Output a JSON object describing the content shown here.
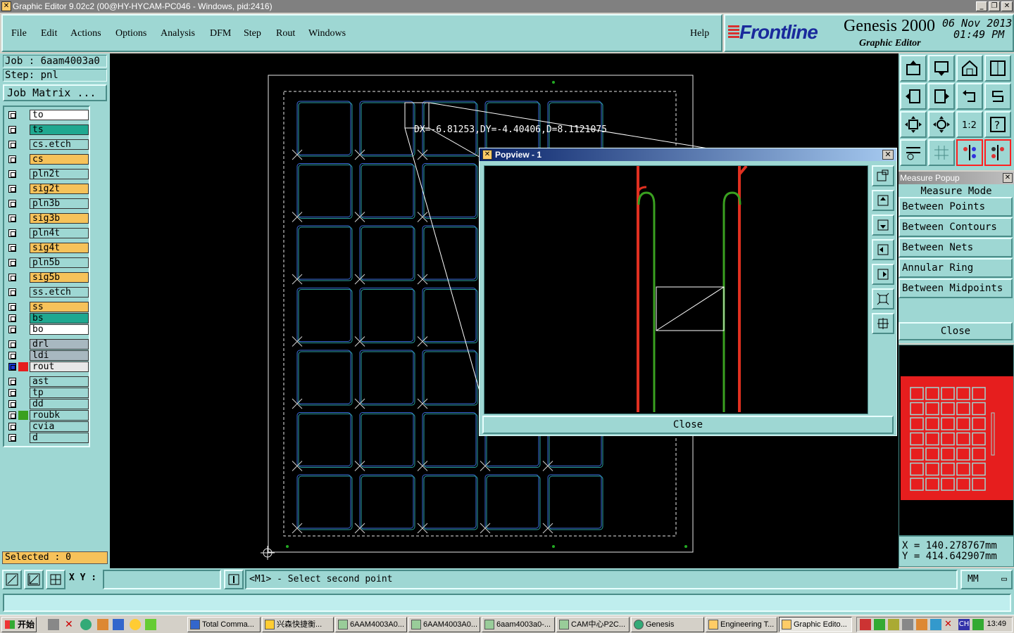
{
  "window": {
    "title": "Graphic Editor 9.02c2 (00@HY-HYCAM-PC046 - Windows, pid:2416)"
  },
  "menu": {
    "items": [
      "File",
      "Edit",
      "Actions",
      "Options",
      "Analysis",
      "DFM",
      "Step",
      "Rout",
      "Windows"
    ],
    "help": "Help"
  },
  "brand": {
    "logo": "Frontline",
    "product": "Genesis 2000",
    "subtitle": "Graphic Editor",
    "date": "06 Nov 2013",
    "time": "01:49 PM"
  },
  "job": {
    "job_label": "Job : 6aam4003a0",
    "step_label": "Step: pnl",
    "matrix_button": "Job Matrix ..."
  },
  "layers": [
    {
      "name": "to",
      "color": "#ffffff"
    },
    {
      "name": "ts",
      "color": "#1fa890"
    },
    {
      "name": "cs.etch",
      "color": "#9ed7d3"
    },
    {
      "name": "cs",
      "color": "#f6c25a"
    },
    {
      "name": "pln2t",
      "color": "#9ed7d3"
    },
    {
      "name": "sig2t",
      "color": "#f6c25a"
    },
    {
      "name": "pln3b",
      "color": "#9ed7d3"
    },
    {
      "name": "sig3b",
      "color": "#f6c25a"
    },
    {
      "name": "pln4t",
      "color": "#9ed7d3"
    },
    {
      "name": "sig4t",
      "color": "#f6c25a"
    },
    {
      "name": "pln5b",
      "color": "#9ed7d3"
    },
    {
      "name": "sig5b",
      "color": "#f6c25a"
    },
    {
      "name": "ss.etch",
      "color": "#9ed7d3"
    },
    {
      "name": "ss",
      "color": "#f6c25a"
    },
    {
      "name": "bs",
      "color": "#1fa890"
    },
    {
      "name": "bo",
      "color": "#ffffff"
    },
    {
      "name": "drl",
      "color": "#a8b8c0"
    },
    {
      "name": "ldi",
      "color": "#a8b8c0"
    },
    {
      "name": "rout",
      "color": "#e8e8e8"
    },
    {
      "name": "ast",
      "color": "#9ed7d3"
    },
    {
      "name": "tp",
      "color": "#9ed7d3"
    },
    {
      "name": "dd",
      "color": "#9ed7d3"
    },
    {
      "name": "roubk",
      "color": "#9ed7d3"
    },
    {
      "name": "cvia",
      "color": "#9ed7d3"
    },
    {
      "name": "d",
      "color": "#9ed7d3"
    }
  ],
  "selected": "Selected : 0",
  "canvas": {
    "measure_text": "DX=-6.81253,DY=-4.40406,D=8.1121075"
  },
  "popview": {
    "title": "Popview - 1",
    "close": "Close"
  },
  "measure": {
    "title": "Measure Popup",
    "mode_label": "Measure Mode",
    "options": [
      "Between Points",
      "Between Contours",
      "Between Nets",
      "Annular Ring",
      "Between Midpoints"
    ],
    "close": "Close"
  },
  "coords": {
    "x": "X = 140.278767mm",
    "y": "Y = 414.642907mm"
  },
  "bottom": {
    "xy_label": "X Y :",
    "xy_value": "",
    "prompt": "<M1> - Select second point",
    "units": "MM"
  },
  "taskbar": {
    "start": "开始",
    "tasks": [
      "Total Comma...",
      "兴森快捷衡...",
      "6AAM4003A0...",
      "6AAM4003A0...",
      "6aam4003a0-...",
      "CAM中心P2C...",
      "Genesis",
      "Engineering T...",
      "Graphic Edito..."
    ],
    "clock": "13:49"
  },
  "colors": {
    "panel": "#9ed7d3",
    "layer_yellow": "#f6c25a",
    "board_line": "#3a6ad8",
    "trace_red": "#e03020",
    "trace_green": "#3aa020"
  }
}
